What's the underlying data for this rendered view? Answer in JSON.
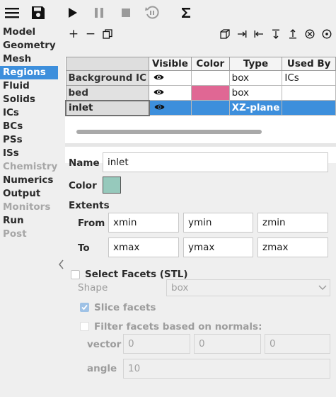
{
  "toolbar": {
    "icons": [
      "menu-icon",
      "save-icon",
      "play-icon",
      "pause-icon",
      "stop-icon",
      "reset-icon",
      "sigma-icon"
    ]
  },
  "sidebar": {
    "items": [
      {
        "label": "Model",
        "state": "normal"
      },
      {
        "label": "Geometry",
        "state": "normal"
      },
      {
        "label": "Mesh",
        "state": "normal"
      },
      {
        "label": "Regions",
        "state": "active"
      },
      {
        "label": "Fluid",
        "state": "normal"
      },
      {
        "label": "Solids",
        "state": "normal"
      },
      {
        "label": "ICs",
        "state": "normal"
      },
      {
        "label": "BCs",
        "state": "normal"
      },
      {
        "label": "PSs",
        "state": "normal"
      },
      {
        "label": "ISs",
        "state": "normal"
      },
      {
        "label": "Chemistry",
        "state": "disabled"
      },
      {
        "label": "Numerics",
        "state": "normal"
      },
      {
        "label": "Output",
        "state": "normal"
      },
      {
        "label": "Monitors",
        "state": "disabled"
      },
      {
        "label": "Run",
        "state": "normal"
      },
      {
        "label": "Post",
        "state": "disabled"
      }
    ]
  },
  "actions": {
    "add": "+",
    "remove": "−"
  },
  "table": {
    "headers": [
      "",
      "Visible",
      "Color",
      "Type",
      "Used By"
    ],
    "rows": [
      {
        "name": "Background IC",
        "visible": true,
        "color": "",
        "type": "box",
        "used_by": "ICs"
      },
      {
        "name": "bed",
        "visible": true,
        "color": "#e06794",
        "type": "box",
        "used_by": ""
      },
      {
        "name": "inlet",
        "visible": true,
        "color": "",
        "type": "XZ-plane",
        "used_by": ""
      }
    ],
    "selected_index": 2
  },
  "form": {
    "name_label": "Name",
    "name_value": "inlet",
    "color_label": "Color",
    "color_value": "#96c9bc",
    "extents_label": "Extents",
    "from_label": "From",
    "to_label": "To",
    "from_values": [
      "xmin",
      "ymin",
      "zmin"
    ],
    "to_values": [
      "xmax",
      "ymax",
      "zmax"
    ],
    "select_facets_label": "Select Facets (STL)",
    "shape_label": "Shape",
    "shape_value": "box",
    "slice_facets_label": "Slice facets",
    "filter_label": "Filter facets based on normals:",
    "vector_label": "vector",
    "vector_values": [
      "0",
      "0",
      "0"
    ],
    "angle_label": "angle",
    "angle_value": "10"
  }
}
